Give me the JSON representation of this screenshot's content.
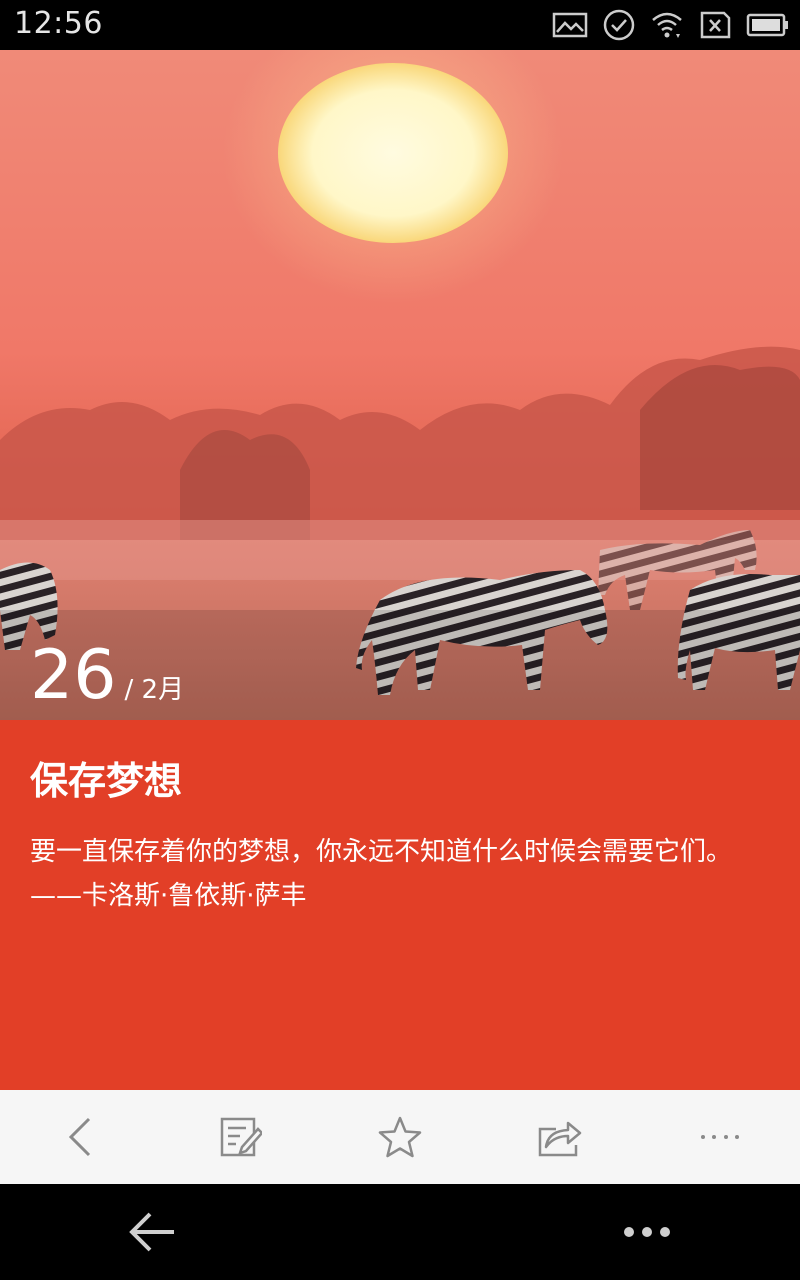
{
  "status_bar": {
    "time": "12:56",
    "icons": [
      "image-icon",
      "check-circle-icon",
      "wifi-icon",
      "no-sim-icon",
      "battery-icon"
    ]
  },
  "hero": {
    "day": "26",
    "month": "/ 2月",
    "image_description_icon": "sunset-zebra-photo"
  },
  "card": {
    "title": "保存梦想",
    "body": "要一直保存着你的梦想，你永远不知道什么时候会需要它们。——卡洛斯·鲁依斯·萨丰",
    "background_color": "#e23f27"
  },
  "toolbar": {
    "icons": [
      "back-icon",
      "note-icon",
      "star-icon",
      "share-icon",
      "more-icon"
    ]
  },
  "navbar": {
    "icons": [
      "back-arrow-icon",
      "more-dots-icon"
    ]
  }
}
